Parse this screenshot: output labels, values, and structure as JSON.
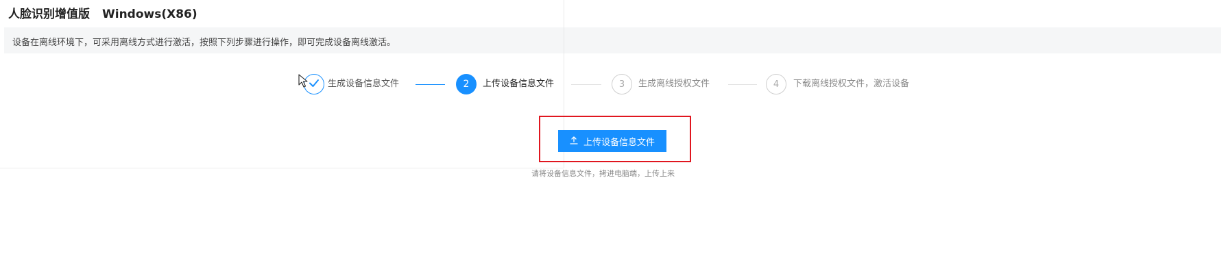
{
  "header": {
    "product_name": "人脸识别增值版",
    "platform": "Windows(X86)"
  },
  "notice": {
    "text": "设备在离线环境下，可采用离线方式进行激活，按照下列步骤进行操作，即可完成设备离线激活。"
  },
  "steps": {
    "items": [
      {
        "number": "1",
        "label": "生成设备信息文件",
        "status": "done",
        "icon": "check-icon"
      },
      {
        "number": "2",
        "label": "上传设备信息文件",
        "status": "active"
      },
      {
        "number": "3",
        "label": "生成离线授权文件",
        "status": "wait"
      },
      {
        "number": "4",
        "label": "下载离线授权文件，激活设备",
        "status": "wait"
      }
    ]
  },
  "upload": {
    "button_label": "上传设备信息文件",
    "button_icon": "upload-icon",
    "hint": "请将设备信息文件，拷进电脑端，上传上来"
  },
  "colors": {
    "accent": "#1890ff",
    "highlight_border": "#e0161f",
    "inactive": "#cfcfcf"
  }
}
